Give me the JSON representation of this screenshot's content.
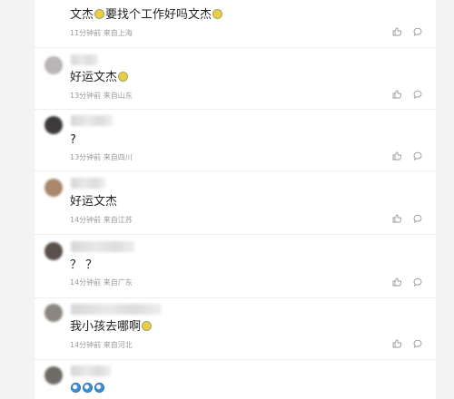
{
  "comments": [
    {
      "text_parts": [
        "文杰",
        "要找个工作好吗文杰",
        ""
      ],
      "emojis": 2,
      "time": "11分钟前",
      "location": "来自上海",
      "avatar_color": "#cfcfcf"
    },
    {
      "text_parts": [
        "好运文杰",
        ""
      ],
      "emojis": 1,
      "time": "13分钟前",
      "location": "来自山东",
      "avatar_color": "#b9b4b6"
    },
    {
      "text_parts": [
        "?"
      ],
      "emojis": 0,
      "time": "13分钟前",
      "location": "来自四川",
      "avatar_color": "#3d3a3c"
    },
    {
      "text_parts": [
        "好运文杰"
      ],
      "emojis": 0,
      "time": "14分钟前",
      "location": "来自江苏",
      "avatar_color": "#a9876a"
    },
    {
      "text_parts": [
        "？ ？"
      ],
      "emojis": 0,
      "time": "14分钟前",
      "location": "来自广东",
      "avatar_color": "#5a4f4c"
    },
    {
      "text_parts": [
        "我小孩去哪啊",
        ""
      ],
      "emojis": 1,
      "time": "14分钟前",
      "location": "来自河北",
      "avatar_color": "#8c8680"
    },
    {
      "text_parts": [
        ""
      ],
      "emojis": 3,
      "time": "",
      "location": "",
      "avatar_color": "#6e6b66"
    }
  ],
  "colors": {
    "emoji_face": "#f3c94a",
    "emoji_blue": "#3f8fd6",
    "meta_text": "#9a9a9a",
    "page_bg": "#f3f3f3"
  },
  "icons": {
    "like": "thumbs-up-icon",
    "reply": "comment-bubble-icon"
  }
}
